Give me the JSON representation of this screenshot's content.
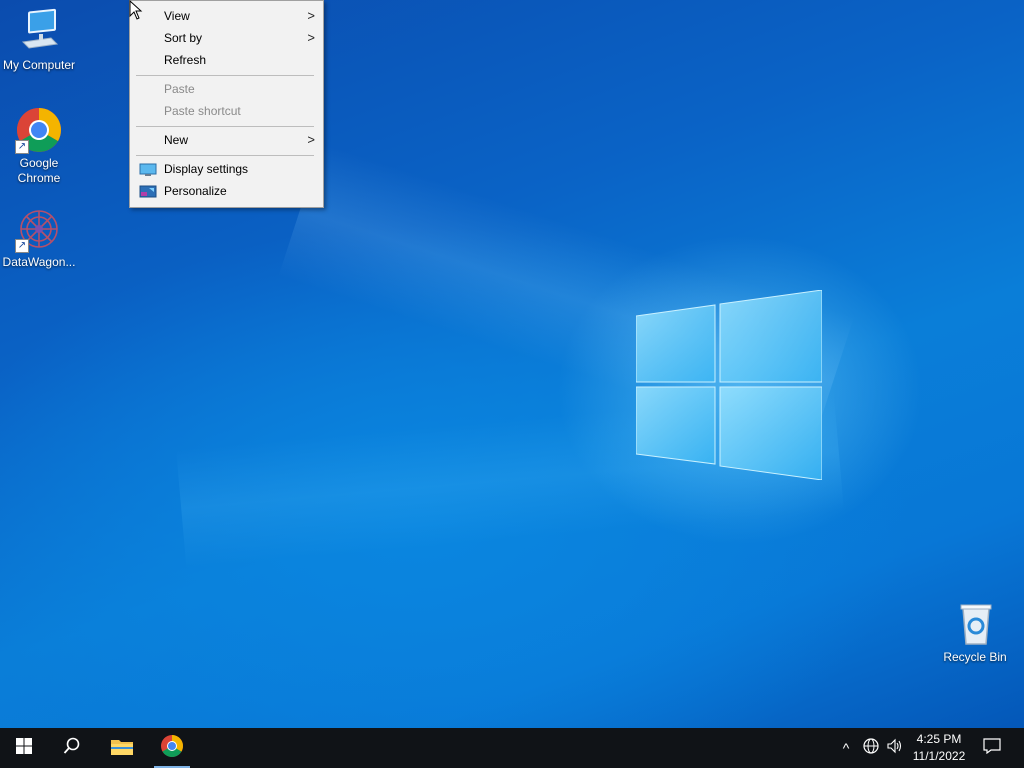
{
  "desktop": {
    "icons": [
      {
        "label": "My Computer",
        "icon": "computer-icon"
      },
      {
        "label": "Google\nChrome",
        "icon": "chrome-icon"
      },
      {
        "label": "DataWagon...",
        "icon": "datawagon-icon"
      },
      {
        "label": "Recycle Bin",
        "icon": "recycle-bin-icon"
      }
    ]
  },
  "context_menu": {
    "items": [
      {
        "label": "View",
        "submenu": true,
        "enabled": true
      },
      {
        "label": "Sort by",
        "submenu": true,
        "enabled": true
      },
      {
        "label": "Refresh",
        "submenu": false,
        "enabled": true
      },
      {
        "label": "Paste",
        "submenu": false,
        "enabled": false
      },
      {
        "label": "Paste shortcut",
        "submenu": false,
        "enabled": false
      },
      {
        "label": "New",
        "submenu": true,
        "enabled": true
      },
      {
        "label": "Display settings",
        "submenu": false,
        "enabled": true,
        "icon": "display-settings-icon"
      },
      {
        "label": "Personalize",
        "submenu": false,
        "enabled": true,
        "icon": "personalize-icon"
      }
    ],
    "submenu_arrow": ">"
  },
  "taskbar": {
    "pinned": [
      {
        "name": "start",
        "icon": "windows-start-icon"
      },
      {
        "name": "search",
        "icon": "search-icon"
      },
      {
        "name": "file-explorer",
        "icon": "folder-icon"
      },
      {
        "name": "chrome",
        "icon": "chrome-icon"
      }
    ],
    "tray": {
      "chevron": "^",
      "time": "4:25 PM",
      "date": "11/1/2022"
    }
  },
  "colors": {
    "desktop_accent": "#0a7ed8",
    "taskbar": "#101317",
    "menu_bg": "#f2f2f2",
    "disabled_text": "#8a8a8a"
  }
}
